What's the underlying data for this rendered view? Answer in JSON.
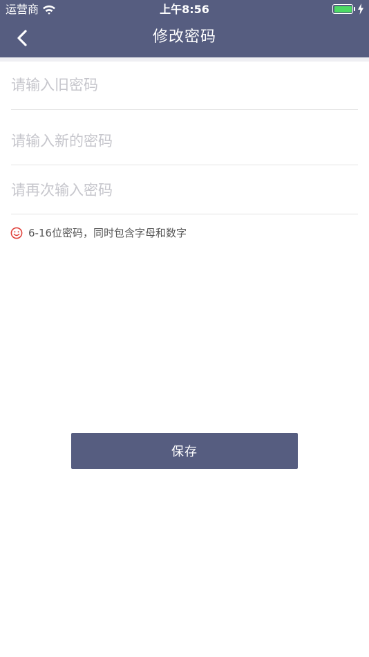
{
  "status_bar": {
    "carrier": "运营商",
    "time": "上午8:56",
    "battery_color": "#4cd964"
  },
  "nav": {
    "title": "修改密码",
    "back_icon": "chevron-left-icon",
    "background": "#565d80"
  },
  "form": {
    "old_password_placeholder": "请输入旧密码",
    "new_password_placeholder": "请输入新的密码",
    "confirm_password_placeholder": "请再次输入密码"
  },
  "hint": {
    "icon": "smile-icon",
    "icon_color": "#e0413a",
    "text": "6-16位密码，同时包含字母和数字"
  },
  "actions": {
    "save_label": "保存"
  }
}
